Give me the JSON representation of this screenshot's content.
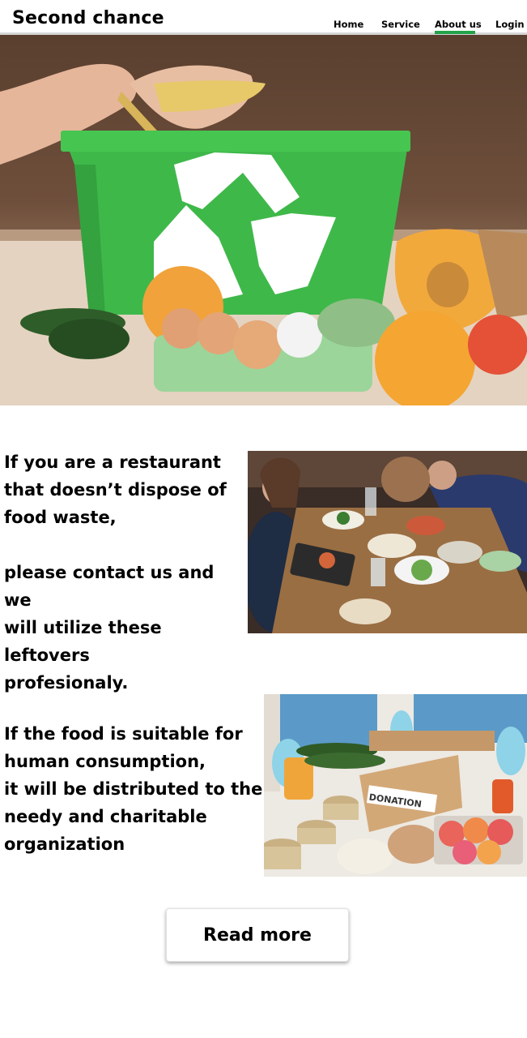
{
  "header": {
    "brand": "Second chance",
    "nav": [
      {
        "label": "Home"
      },
      {
        "label": "Service"
      },
      {
        "label": "About us",
        "active": true
      },
      {
        "label": "Login"
      }
    ],
    "accent_color": "#22a34a"
  },
  "hero": {
    "image": "recycling-bin-food-waste-photo"
  },
  "section1": {
    "text": "If you are a  restaurant\nthat doesn’t dispose of\nfood waste,\n\nplease contact us and we\nwill utilize these leftovers\nprofesionaly.",
    "image": "restaurant-table-photo"
  },
  "section2": {
    "text": "If the food is suitable for\nhuman consumption,\n it will be distributed  to the\nneedy and charitable\norganization",
    "image": "donation-box-photo",
    "box_label": "DONATION"
  },
  "cta": {
    "label": "Read more"
  }
}
